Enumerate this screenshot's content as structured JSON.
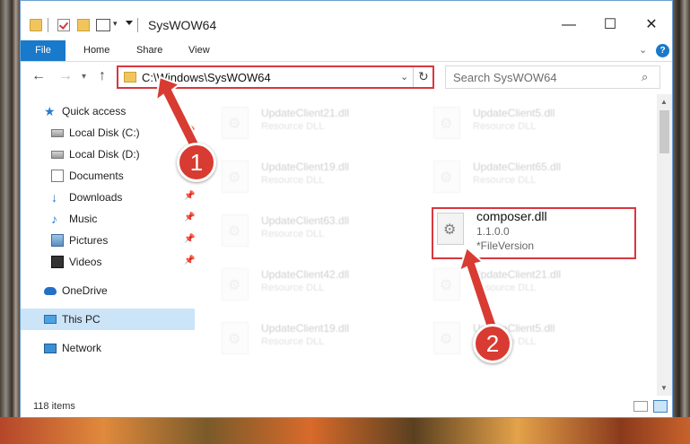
{
  "window": {
    "title": "SysWOW64",
    "controls": {
      "minimize": "—",
      "maximize": "☐",
      "close": "✕"
    }
  },
  "ribbon": {
    "tabs": [
      {
        "label": "File",
        "active": true
      },
      {
        "label": "Home"
      },
      {
        "label": "Share"
      },
      {
        "label": "View"
      }
    ],
    "help": "?"
  },
  "navbar": {
    "address": "C:\\Windows\\SysWOW64",
    "search_placeholder": "Search SysWOW64",
    "icons": [
      "back-arrow-icon",
      "forward-arrow-icon",
      "recent-locations-icon",
      "up-arrow-icon",
      "refresh-icon",
      "search-icon"
    ]
  },
  "sidebar": {
    "items": [
      {
        "label": "Quick access",
        "icon": "star-icon"
      },
      {
        "label": "Local Disk (C:)",
        "icon": "drive-icon",
        "pinned": true
      },
      {
        "label": "Local Disk (D:)",
        "icon": "drive-icon"
      },
      {
        "label": "Documents",
        "icon": "documents-icon",
        "pinned": true
      },
      {
        "label": "Downloads",
        "icon": "download-icon",
        "pinned": true
      },
      {
        "label": "Music",
        "icon": "music-icon",
        "pinned": true
      },
      {
        "label": "Pictures",
        "icon": "pictures-icon",
        "pinned": true
      },
      {
        "label": "Videos",
        "icon": "videos-icon",
        "pinned": true
      },
      {
        "label": "OneDrive",
        "icon": "cloud-icon"
      },
      {
        "label": "This PC",
        "icon": "computer-icon",
        "selected": true
      },
      {
        "label": "Network",
        "icon": "network-icon"
      }
    ]
  },
  "files": [
    {
      "name": "UpdateClient21.dll",
      "type": "Resource DLL"
    },
    {
      "name": "UpdateClient5.dll",
      "type": "Resource DLL"
    },
    {
      "name": "UpdateClient19.dll",
      "type": "Resource DLL"
    },
    {
      "name": "UpdateClient65.dll",
      "type": "Resource DLL"
    },
    {
      "name": "UpdateClient63.dll",
      "type": "Resource DLL"
    },
    {
      "name": "composer.dll",
      "version": "1.1.0.0",
      "desc": "*FileVersion"
    },
    {
      "name": "UpdateClient42.dll",
      "type": "Resource DLL"
    },
    {
      "name": "UpdateClient21.dll",
      "type": "Resource DLL"
    },
    {
      "name": "UpdateClient19.dll",
      "type": "Resource DLL"
    },
    {
      "name": "UpdateClient5.dll",
      "type": "Resource DLL"
    }
  ],
  "status": {
    "count": "118 items"
  },
  "annotations": [
    {
      "number": "1"
    },
    {
      "number": "2"
    }
  ],
  "colors": {
    "accent": "#1979ca",
    "highlight_red": "#d9373f",
    "badge_red": "#d83b32",
    "selection": "#cce4f7"
  }
}
